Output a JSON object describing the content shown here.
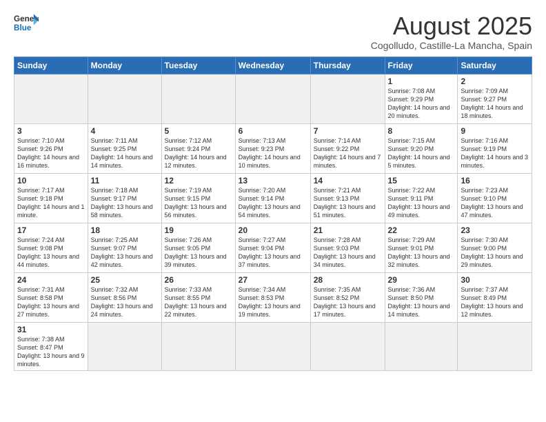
{
  "header": {
    "logo_general": "General",
    "logo_blue": "Blue",
    "month_title": "August 2025",
    "location": "Cogolludo, Castille-La Mancha, Spain"
  },
  "weekdays": [
    "Sunday",
    "Monday",
    "Tuesday",
    "Wednesday",
    "Thursday",
    "Friday",
    "Saturday"
  ],
  "weeks": [
    [
      {
        "day": "",
        "info": "",
        "empty": true
      },
      {
        "day": "",
        "info": "",
        "empty": true
      },
      {
        "day": "",
        "info": "",
        "empty": true
      },
      {
        "day": "",
        "info": "",
        "empty": true
      },
      {
        "day": "",
        "info": "",
        "empty": true
      },
      {
        "day": "1",
        "info": "Sunrise: 7:08 AM\nSunset: 9:29 PM\nDaylight: 14 hours\nand 20 minutes."
      },
      {
        "day": "2",
        "info": "Sunrise: 7:09 AM\nSunset: 9:27 PM\nDaylight: 14 hours\nand 18 minutes."
      }
    ],
    [
      {
        "day": "3",
        "info": "Sunrise: 7:10 AM\nSunset: 9:26 PM\nDaylight: 14 hours\nand 16 minutes."
      },
      {
        "day": "4",
        "info": "Sunrise: 7:11 AM\nSunset: 9:25 PM\nDaylight: 14 hours\nand 14 minutes."
      },
      {
        "day": "5",
        "info": "Sunrise: 7:12 AM\nSunset: 9:24 PM\nDaylight: 14 hours\nand 12 minutes."
      },
      {
        "day": "6",
        "info": "Sunrise: 7:13 AM\nSunset: 9:23 PM\nDaylight: 14 hours\nand 10 minutes."
      },
      {
        "day": "7",
        "info": "Sunrise: 7:14 AM\nSunset: 9:22 PM\nDaylight: 14 hours\nand 7 minutes."
      },
      {
        "day": "8",
        "info": "Sunrise: 7:15 AM\nSunset: 9:20 PM\nDaylight: 14 hours\nand 5 minutes."
      },
      {
        "day": "9",
        "info": "Sunrise: 7:16 AM\nSunset: 9:19 PM\nDaylight: 14 hours\nand 3 minutes."
      }
    ],
    [
      {
        "day": "10",
        "info": "Sunrise: 7:17 AM\nSunset: 9:18 PM\nDaylight: 14 hours\nand 1 minute."
      },
      {
        "day": "11",
        "info": "Sunrise: 7:18 AM\nSunset: 9:17 PM\nDaylight: 13 hours\nand 58 minutes."
      },
      {
        "day": "12",
        "info": "Sunrise: 7:19 AM\nSunset: 9:15 PM\nDaylight: 13 hours\nand 56 minutes."
      },
      {
        "day": "13",
        "info": "Sunrise: 7:20 AM\nSunset: 9:14 PM\nDaylight: 13 hours\nand 54 minutes."
      },
      {
        "day": "14",
        "info": "Sunrise: 7:21 AM\nSunset: 9:13 PM\nDaylight: 13 hours\nand 51 minutes."
      },
      {
        "day": "15",
        "info": "Sunrise: 7:22 AM\nSunset: 9:11 PM\nDaylight: 13 hours\nand 49 minutes."
      },
      {
        "day": "16",
        "info": "Sunrise: 7:23 AM\nSunset: 9:10 PM\nDaylight: 13 hours\nand 47 minutes."
      }
    ],
    [
      {
        "day": "17",
        "info": "Sunrise: 7:24 AM\nSunset: 9:08 PM\nDaylight: 13 hours\nand 44 minutes."
      },
      {
        "day": "18",
        "info": "Sunrise: 7:25 AM\nSunset: 9:07 PM\nDaylight: 13 hours\nand 42 minutes."
      },
      {
        "day": "19",
        "info": "Sunrise: 7:26 AM\nSunset: 9:05 PM\nDaylight: 13 hours\nand 39 minutes."
      },
      {
        "day": "20",
        "info": "Sunrise: 7:27 AM\nSunset: 9:04 PM\nDaylight: 13 hours\nand 37 minutes."
      },
      {
        "day": "21",
        "info": "Sunrise: 7:28 AM\nSunset: 9:03 PM\nDaylight: 13 hours\nand 34 minutes."
      },
      {
        "day": "22",
        "info": "Sunrise: 7:29 AM\nSunset: 9:01 PM\nDaylight: 13 hours\nand 32 minutes."
      },
      {
        "day": "23",
        "info": "Sunrise: 7:30 AM\nSunset: 9:00 PM\nDaylight: 13 hours\nand 29 minutes."
      }
    ],
    [
      {
        "day": "24",
        "info": "Sunrise: 7:31 AM\nSunset: 8:58 PM\nDaylight: 13 hours\nand 27 minutes."
      },
      {
        "day": "25",
        "info": "Sunrise: 7:32 AM\nSunset: 8:56 PM\nDaylight: 13 hours\nand 24 minutes."
      },
      {
        "day": "26",
        "info": "Sunrise: 7:33 AM\nSunset: 8:55 PM\nDaylight: 13 hours\nand 22 minutes."
      },
      {
        "day": "27",
        "info": "Sunrise: 7:34 AM\nSunset: 8:53 PM\nDaylight: 13 hours\nand 19 minutes."
      },
      {
        "day": "28",
        "info": "Sunrise: 7:35 AM\nSunset: 8:52 PM\nDaylight: 13 hours\nand 17 minutes."
      },
      {
        "day": "29",
        "info": "Sunrise: 7:36 AM\nSunset: 8:50 PM\nDaylight: 13 hours\nand 14 minutes."
      },
      {
        "day": "30",
        "info": "Sunrise: 7:37 AM\nSunset: 8:49 PM\nDaylight: 13 hours\nand 12 minutes."
      }
    ],
    [
      {
        "day": "31",
        "info": "Sunrise: 7:38 AM\nSunset: 8:47 PM\nDaylight: 13 hours\nand 9 minutes.",
        "last": true
      },
      {
        "day": "",
        "info": "",
        "empty": true,
        "last": true
      },
      {
        "day": "",
        "info": "",
        "empty": true,
        "last": true
      },
      {
        "day": "",
        "info": "",
        "empty": true,
        "last": true
      },
      {
        "day": "",
        "info": "",
        "empty": true,
        "last": true
      },
      {
        "day": "",
        "info": "",
        "empty": true,
        "last": true
      },
      {
        "day": "",
        "info": "",
        "empty": true,
        "last": true
      }
    ]
  ]
}
